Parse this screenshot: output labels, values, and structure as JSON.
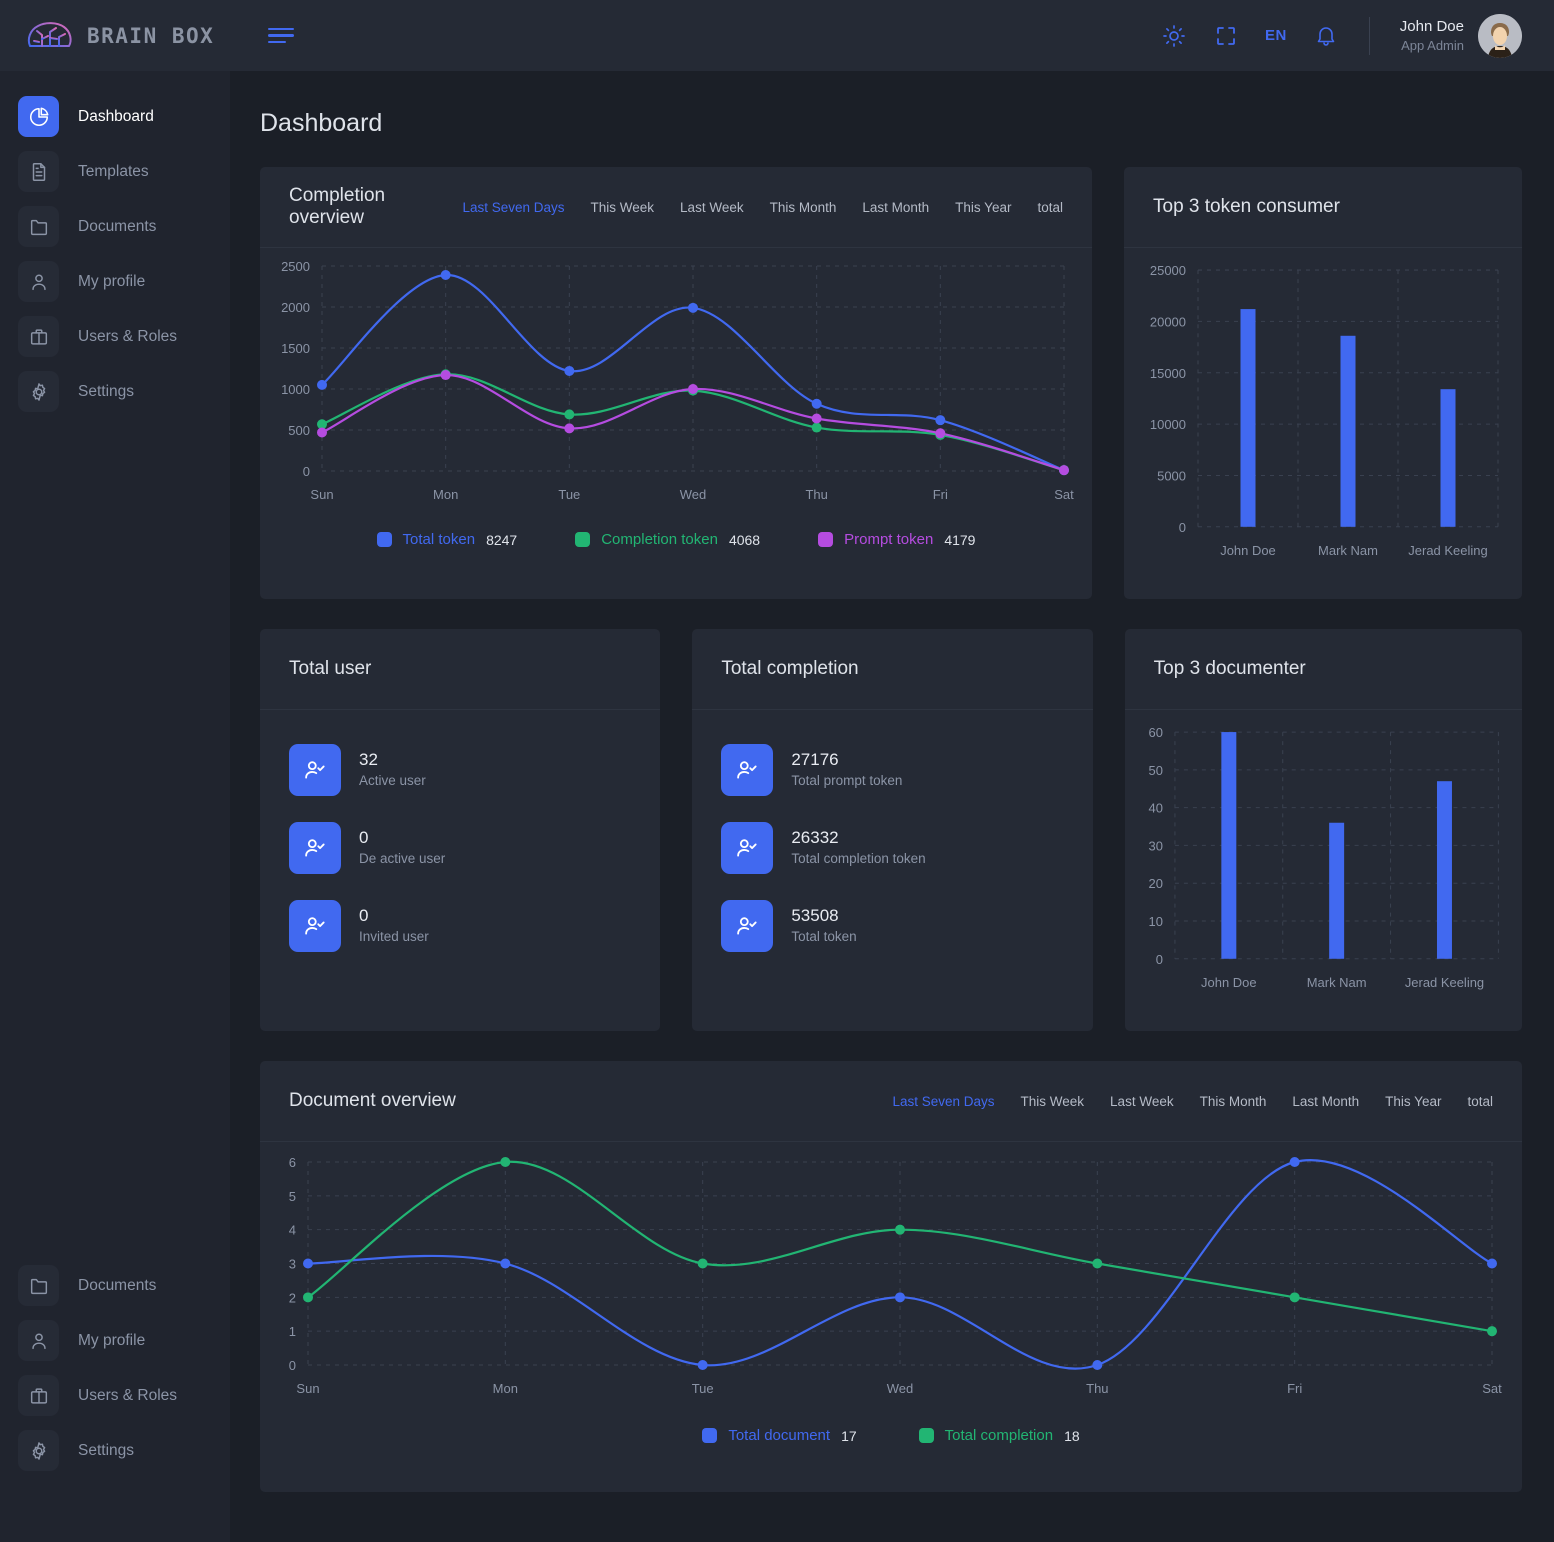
{
  "brand": {
    "name": "BRAIN BOX"
  },
  "header": {
    "theme_icon": "sun-icon",
    "fullscreen_icon": "fullscreen-icon",
    "language": "EN",
    "notification_icon": "bell-icon",
    "user_name": "John Doe",
    "user_role": "App Admin"
  },
  "sidebar": {
    "primary": [
      {
        "label": "Dashboard",
        "icon": "pie-chart-icon",
        "active": true
      },
      {
        "label": "Templates",
        "icon": "document-icon",
        "active": false
      },
      {
        "label": "Documents",
        "icon": "folder-icon",
        "active": false
      },
      {
        "label": "My profile",
        "icon": "user-icon",
        "active": false
      },
      {
        "label": "Users & Roles",
        "icon": "briefcase-icon",
        "active": false
      },
      {
        "label": "Settings",
        "icon": "gear-icon",
        "active": false
      }
    ],
    "secondary": [
      {
        "label": "Documents",
        "icon": "folder-icon"
      },
      {
        "label": "My profile",
        "icon": "user-icon"
      },
      {
        "label": "Users & Roles",
        "icon": "briefcase-icon"
      },
      {
        "label": "Settings",
        "icon": "gear-icon"
      }
    ]
  },
  "page": {
    "title": "Dashboard"
  },
  "colors": {
    "accent": "#4169f0",
    "blue": "#4169f0",
    "green": "#22b573",
    "purple": "#b54ce0",
    "card_bg": "#252a35",
    "page_bg": "#1b1f27"
  },
  "range_tabs": [
    "Last Seven Days",
    "This Week",
    "Last Week",
    "This Month",
    "Last Month",
    "This Year",
    "total"
  ],
  "completion_overview": {
    "title": "Completion overview",
    "active_tab": "Last Seven Days",
    "legend": [
      {
        "label": "Total token",
        "value": "8247",
        "color": "#4169f0"
      },
      {
        "label": "Completion token",
        "value": "4068",
        "color": "#22b573"
      },
      {
        "label": "Prompt token",
        "value": "4179",
        "color": "#b54ce0"
      }
    ]
  },
  "top_token_consumer": {
    "title": "Top 3 token consumer"
  },
  "top_documenter": {
    "title": "Top 3 documenter"
  },
  "total_user": {
    "title": "Total user",
    "rows": [
      {
        "value": "32",
        "label": "Active user",
        "icon": "user-check-icon"
      },
      {
        "value": "0",
        "label": "De active user",
        "icon": "user-check-icon"
      },
      {
        "value": "0",
        "label": "Invited user",
        "icon": "user-check-icon"
      }
    ]
  },
  "total_completion": {
    "title": "Total completion",
    "rows": [
      {
        "value": "27176",
        "label": "Total prompt token",
        "icon": "user-check-icon"
      },
      {
        "value": "26332",
        "label": "Total completion token",
        "icon": "user-check-icon"
      },
      {
        "value": "53508",
        "label": "Total token",
        "icon": "user-check-icon"
      }
    ]
  },
  "document_overview": {
    "title": "Document overview",
    "active_tab": "Last Seven Days",
    "legend": [
      {
        "label": "Total document",
        "value": "17",
        "color": "#4169f0"
      },
      {
        "label": "Total completion",
        "value": "18",
        "color": "#22b573"
      }
    ]
  },
  "chart_data": [
    {
      "id": "completion-overview",
      "type": "line",
      "title": "Completion overview",
      "xlabel": "",
      "ylabel": "",
      "categories": [
        "Sun",
        "Mon",
        "Tue",
        "Wed",
        "Thu",
        "Fri",
        "Sat"
      ],
      "yticks": [
        0,
        500,
        1000,
        1500,
        2000,
        2500
      ],
      "ylim": [
        0,
        2500
      ],
      "grid": true,
      "legend_position": "bottom",
      "series": [
        {
          "name": "Total token",
          "color": "#4169f0",
          "values": [
            1050,
            2390,
            1220,
            1990,
            820,
            620,
            10
          ]
        },
        {
          "name": "Completion token",
          "color": "#22b573",
          "values": [
            570,
            1180,
            690,
            980,
            530,
            440,
            10
          ]
        },
        {
          "name": "Prompt token",
          "color": "#b54ce0",
          "values": [
            470,
            1170,
            520,
            1000,
            640,
            460,
            10
          ]
        }
      ]
    },
    {
      "id": "top-3-token-consumer",
      "type": "bar",
      "title": "Top 3 token consumer",
      "xlabel": "",
      "ylabel": "",
      "categories": [
        "John Doe",
        "Mark Nam",
        "Jerad Keeling"
      ],
      "values": [
        21200,
        18600,
        13400
      ],
      "yticks": [
        0,
        5000,
        10000,
        15000,
        20000,
        25000
      ],
      "ylim": [
        0,
        25000
      ],
      "grid": true,
      "color": "#4169f0"
    },
    {
      "id": "top-3-documenter",
      "type": "bar",
      "title": "Top 3 documenter",
      "xlabel": "",
      "ylabel": "",
      "categories": [
        "John Doe",
        "Mark Nam",
        "Jerad Keeling"
      ],
      "values": [
        60,
        36,
        47
      ],
      "yticks": [
        0,
        10,
        20,
        30,
        40,
        50,
        60
      ],
      "ylim": [
        0,
        60
      ],
      "grid": true,
      "color": "#4169f0"
    },
    {
      "id": "document-overview",
      "type": "line",
      "title": "Document overview",
      "xlabel": "",
      "ylabel": "",
      "categories": [
        "Sun",
        "Mon",
        "Tue",
        "Wed",
        "Thu",
        "Fri",
        "Sat"
      ],
      "yticks": [
        0,
        1,
        2,
        3,
        4,
        5,
        6
      ],
      "ylim": [
        0,
        6
      ],
      "grid": true,
      "legend_position": "bottom",
      "series": [
        {
          "name": "Total document",
          "color": "#4169f0",
          "values": [
            3,
            3,
            0,
            2,
            0,
            6,
            3
          ]
        },
        {
          "name": "Total completion",
          "color": "#22b573",
          "values": [
            2,
            6,
            3,
            4,
            3,
            2,
            1
          ]
        }
      ]
    }
  ]
}
